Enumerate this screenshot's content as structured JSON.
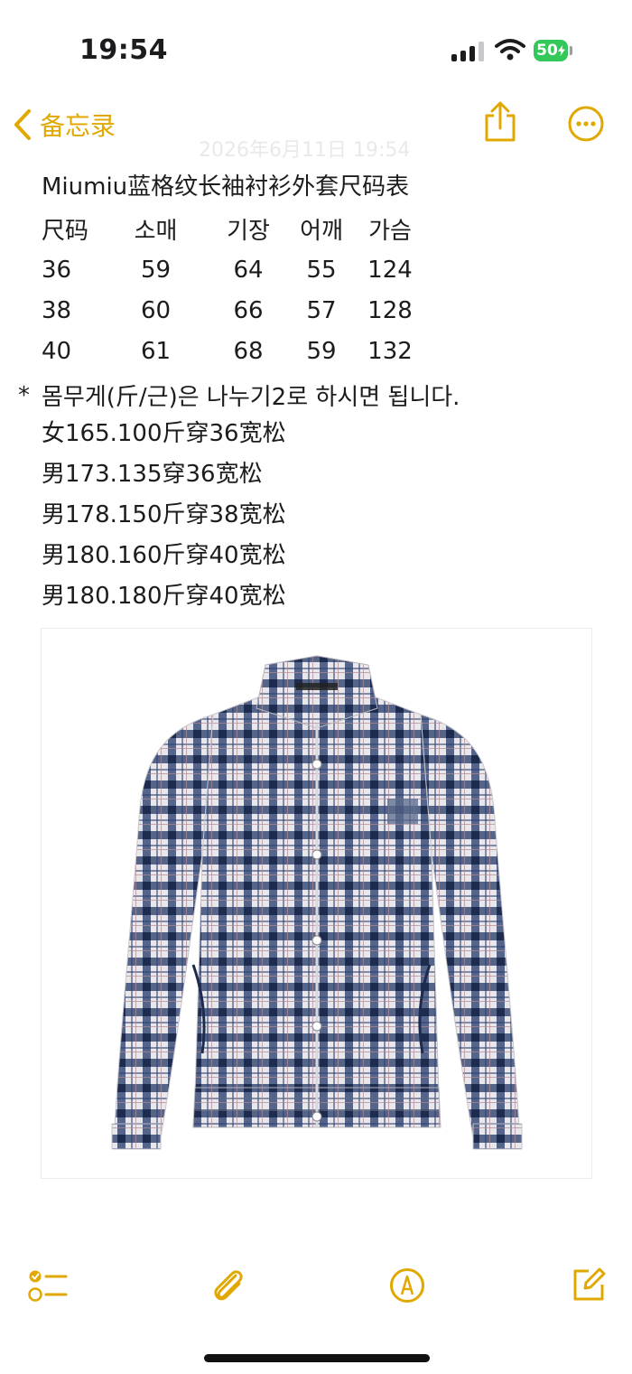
{
  "status_bar": {
    "time": "19:54",
    "battery": "50"
  },
  "nav": {
    "back_label": "备忘录"
  },
  "note": {
    "ghost_date": "2026年6月11日 19:54",
    "title": "Miumiu蓝格纹长袖衬衫外套尺码表",
    "table_headers": [
      "尺码",
      "소매",
      "기장",
      "어깨",
      "가슴"
    ],
    "table_rows": [
      [
        "36",
        "59",
        "64",
        "55",
        "124"
      ],
      [
        "38",
        "60",
        "66",
        "57",
        "128"
      ],
      [
        "40",
        "61",
        "68",
        "59",
        "132"
      ]
    ],
    "star": "*",
    "note_line": "몸무게(斤/근)은 나누기2로 하시면 됩니다.",
    "recommendations": [
      "女165.100斤穿36宽松",
      "男173.135穿36宽松",
      "男178.150斤穿38宽松",
      "男180.160斤穿40宽松",
      "男180.180斤穿40宽松"
    ]
  },
  "colors": {
    "accent": "#e0a800",
    "battery": "#34c759",
    "plaid_navy": "#2c3f6e"
  },
  "icons": {
    "back": "chevron-left-icon",
    "share": "share-icon",
    "more": "more-icon",
    "checklist": "checklist-icon",
    "attachment": "paperclip-icon",
    "markup": "markup-pen-icon",
    "compose": "compose-icon"
  }
}
